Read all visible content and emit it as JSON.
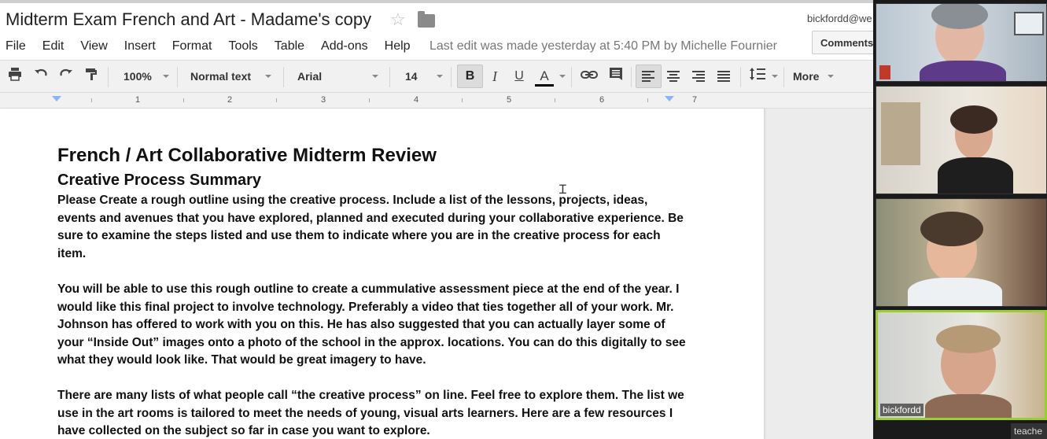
{
  "document": {
    "title": "Midterm Exam French and Art - Madame's copy",
    "last_edit": "Last edit was made yesterday at 5:40 PM by Michelle Fournier"
  },
  "account": {
    "email": "bickfordd@we"
  },
  "header": {
    "comments_label": "Comments"
  },
  "menu": [
    "File",
    "Edit",
    "View",
    "Insert",
    "Format",
    "Tools",
    "Table",
    "Add-ons",
    "Help"
  ],
  "toolbar": {
    "zoom": "100%",
    "style": "Normal text",
    "font": "Arial",
    "size": "14",
    "bold": "B",
    "italic": "I",
    "underline": "U",
    "text_color": "A",
    "more": "More"
  },
  "ruler": {
    "numbers": [
      "1",
      "2",
      "3",
      "4",
      "5",
      "6",
      "7"
    ]
  },
  "content": {
    "heading": "French / Art Collaborative Midterm Review",
    "subheading": "Creative Process Summary",
    "paragraphs": [
      "Please Create a rough outline using the creative process. Include a list of the lessons, projects, ideas, events and avenues that you have explored, planned and executed during your collaborative experience. Be sure to examine the steps listed and use them to indicate where you are in the creative process for each item.",
      "You will be able to use this rough outline to create a cummulative assessment piece at the end of the year. I would like this final project to involve technology. Preferably a video that ties together all of your work. Mr. Johnson has offered to work with you on this. He has also suggested that you can actually layer some of your “Inside Out” images onto a photo of the school in the approx. locations. You can do this digitally to see what they would look like. That would be great imagery to have.",
      "There are many lists of what people call “the creative process” on line. Feel free to explore them. The list we use in the art rooms is tailored to meet the needs of young, visual arts learners. Here are a few resources I have collected on the subject so far in case you want to explore."
    ]
  },
  "video": {
    "active_name": "bickfordd",
    "corner_label": "teache"
  },
  "colors": {
    "active_speaker": "#9acd32",
    "text_color_underline": "#000000"
  }
}
